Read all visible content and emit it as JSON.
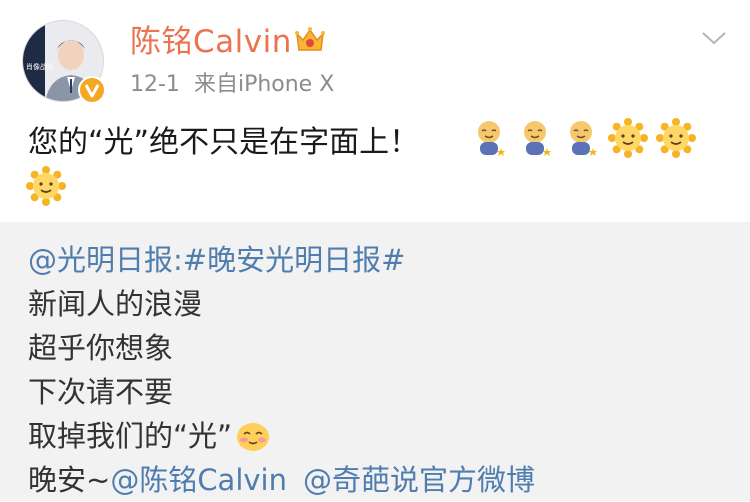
{
  "header": {
    "username": "陈铭Calvin",
    "date": "12-1",
    "source_prefix": "来自",
    "source_device": "iPhone X",
    "avatar_tag": "肖像战队"
  },
  "post": {
    "text": "您的“光”绝不只是在字面上！",
    "emojis": [
      "baby-emoji",
      "baby-emoji",
      "baby-emoji",
      "sun-emoji",
      "sun-emoji",
      "sun-emoji"
    ]
  },
  "repost": {
    "mention_source": "@光明日报",
    "colon": ":",
    "hashtag": "#晚安光明日报#",
    "lines": [
      "新闻人的浪漫",
      "超乎你想象",
      "下次请不要"
    ],
    "last_line_text": "取掉我们的“光”",
    "last_line_emoji": "smile-blush-emoji",
    "goodnight_prefix": "晚安~",
    "mention_1": "@陈铭Calvin",
    "mention_2": "@奇葩说官方微博"
  },
  "colors": {
    "username": "#eb7350",
    "link": "#507daf",
    "meta": "#8c8c8c",
    "repost_bg": "#f2f2f2",
    "verified": "#f5a623"
  }
}
